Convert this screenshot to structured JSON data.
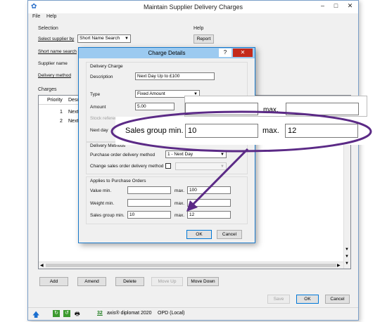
{
  "window": {
    "title": "Maintain Supplier Delivery Charges",
    "menu": [
      "File",
      "Help"
    ]
  },
  "selection": {
    "group_label": "Selection",
    "select_supplier_by_label": "Select supplier by",
    "select_supplier_by_value": "Short Name Search",
    "short_name_search_label": "Short name search",
    "supplier_name_label": "Supplier name",
    "delivery_method_label": "Delivery method"
  },
  "help": {
    "group_label": "Help",
    "report_button": "Report"
  },
  "charges": {
    "group_label": "Charges",
    "columns": [
      "Priority",
      "Desc"
    ],
    "rows": [
      {
        "priority": "1",
        "desc": "Next"
      },
      {
        "priority": "2",
        "desc": "Next"
      }
    ]
  },
  "action_buttons": {
    "add": "Add",
    "amend": "Amend",
    "delete": "Delete",
    "move_up": "Move Up",
    "move_down": "Move Down"
  },
  "bottom_buttons": {
    "save": "Save",
    "ok": "OK",
    "cancel": "Cancel"
  },
  "status_bar": {
    "count": "32",
    "product": "axis® diplomat 2020",
    "database": "OPD (Local)"
  },
  "dialog": {
    "title": "Charge Details",
    "help_glyph": "?",
    "close_glyph": "✕",
    "delivery_charge_group": "Delivery Charge",
    "description_label": "Description",
    "description_value": "Next Day Up to £100",
    "type_label": "Type",
    "type_value": "Fixed Amount",
    "amount_label": "Amount",
    "amount_value": "5.00",
    "stock_reference_label": "Stock reference",
    "next_day_label": "Next day",
    "max_label_partial": "max.",
    "delivery_methods_group": "Delivery Methods",
    "po_method_label": "Purchase order delivery method",
    "po_method_value": "1 - Next Day",
    "so_method_label": "Change sales order delivery method",
    "applies_group": "Applies to Purchase Orders",
    "value_min_label": "Value min.",
    "value_max_label": "max.",
    "value_max_value": "100",
    "weight_min_label": "Weight min.",
    "weight_max_label": "max.",
    "sales_group_min_label": "Sales group min.",
    "sales_group_min_value": "10",
    "sales_group_max_label": "max.",
    "sales_group_max_value": "12",
    "ok": "OK",
    "cancel": "Cancel"
  },
  "zoom_callout": {
    "sales_group_min_label": "Sales group min.",
    "sales_group_min_value": "10",
    "max_label": "max.",
    "max_value": "12",
    "top_max_label": "max."
  },
  "colors": {
    "highlight_ellipse": "#5b2a86",
    "dialog_title_bar": "#9ccaf0",
    "window_border": "#7a9ec8"
  }
}
